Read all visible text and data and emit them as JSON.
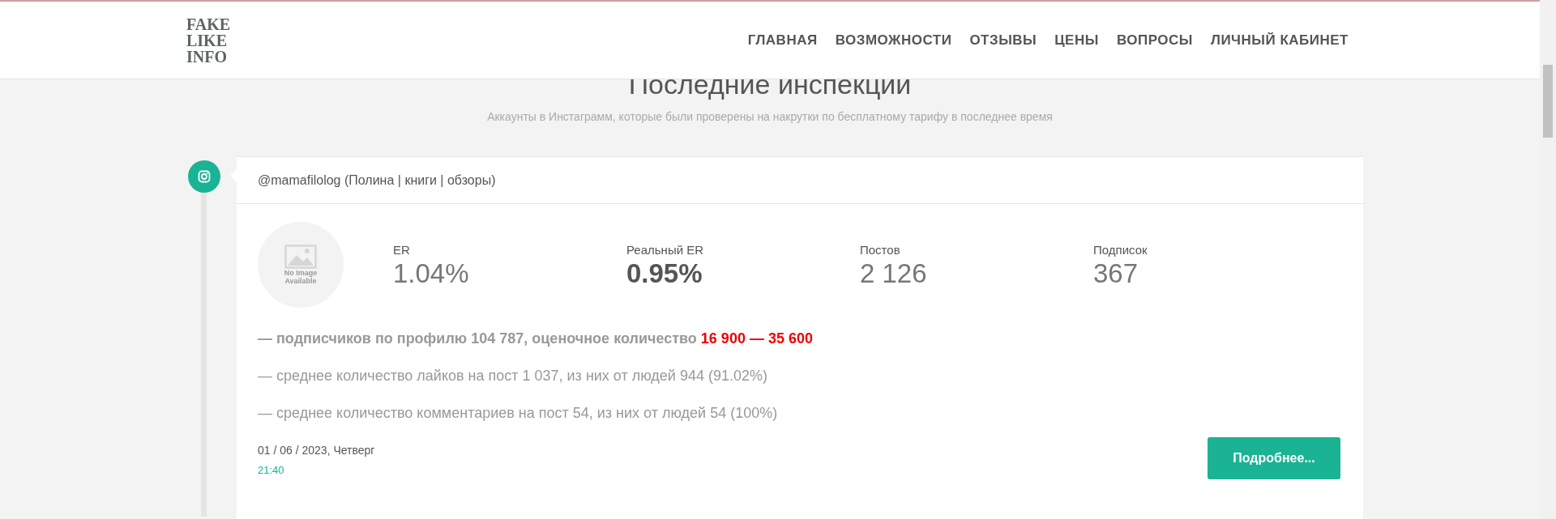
{
  "header": {
    "logo": [
      "FAKE",
      "LIKE",
      "INFO"
    ],
    "nav": [
      {
        "label": "ГЛАВНАЯ"
      },
      {
        "label": "ВОЗМОЖНОСТИ"
      },
      {
        "label": "ОТЗЫВЫ"
      },
      {
        "label": "ЦЕНЫ"
      },
      {
        "label": "ВОПРОСЫ"
      },
      {
        "label": "ЛИЧНЫЙ КАБИНЕТ"
      }
    ]
  },
  "section": {
    "title": "Последние инспекции",
    "subtitle": "Аккаунты в Инстаграмм, которые были проверены на накрутки по бесплатному тарифу в последнее время"
  },
  "inspections": [
    {
      "account": "@mamafilolog (Полина | книги | обзоры)",
      "avatar": {
        "text": "No Image Available"
      },
      "stats": [
        {
          "label": "ER",
          "value": "1.04%",
          "bold": false
        },
        {
          "label": "Реальный ER",
          "value": "0.95%",
          "bold": true
        },
        {
          "label": "Постов",
          "value": "2 126",
          "bold": false
        },
        {
          "label": "Подписок",
          "value": "367",
          "bold": false
        }
      ],
      "lines": [
        {
          "text": "— подписчиков по профилю 104 787, оценочное количество",
          "highlight": "16 900 — 35 600",
          "bold": true
        },
        {
          "text": "— среднее количество лайков на пост 1 037, из них от людей 944 (91.02%)",
          "bold": false
        },
        {
          "text": "— среднее количество комментариев на пост 54, из них от людей 54 (100%)",
          "bold": false
        }
      ],
      "date": "01 / 06 / 2023, Четверг",
      "time": "21:40",
      "button": "Подробнее..."
    }
  ]
}
